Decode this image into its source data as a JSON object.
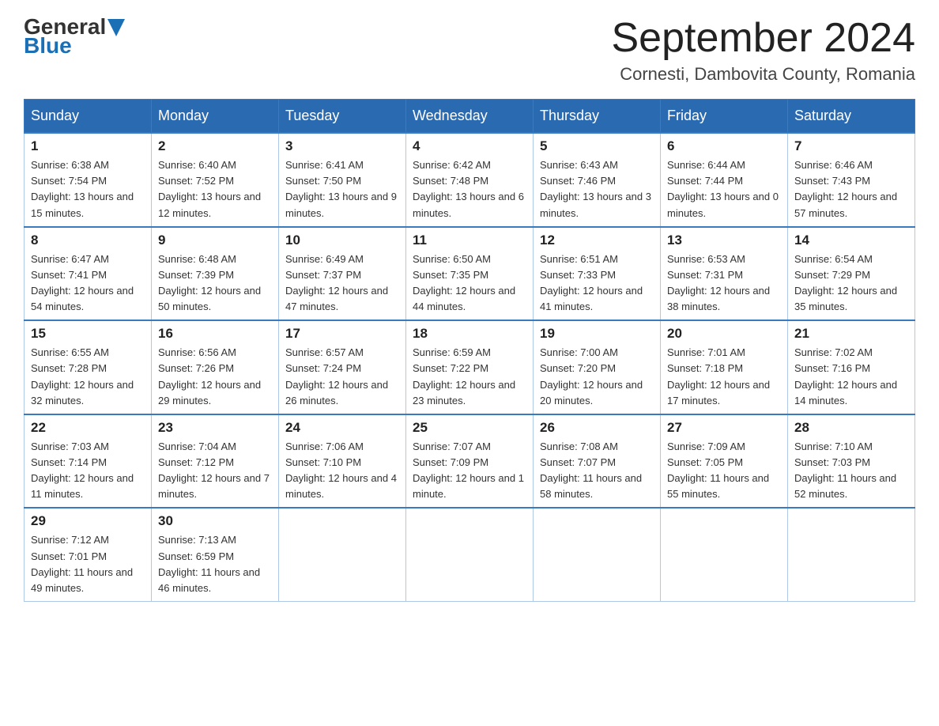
{
  "header": {
    "logo_general": "General",
    "logo_blue": "Blue",
    "month_title": "September 2024",
    "location": "Cornesti, Dambovita County, Romania"
  },
  "weekdays": [
    "Sunday",
    "Monday",
    "Tuesday",
    "Wednesday",
    "Thursday",
    "Friday",
    "Saturday"
  ],
  "weeks": [
    [
      {
        "day": "1",
        "sunrise": "6:38 AM",
        "sunset": "7:54 PM",
        "daylight": "13 hours and 15 minutes."
      },
      {
        "day": "2",
        "sunrise": "6:40 AM",
        "sunset": "7:52 PM",
        "daylight": "13 hours and 12 minutes."
      },
      {
        "day": "3",
        "sunrise": "6:41 AM",
        "sunset": "7:50 PM",
        "daylight": "13 hours and 9 minutes."
      },
      {
        "day": "4",
        "sunrise": "6:42 AM",
        "sunset": "7:48 PM",
        "daylight": "13 hours and 6 minutes."
      },
      {
        "day": "5",
        "sunrise": "6:43 AM",
        "sunset": "7:46 PM",
        "daylight": "13 hours and 3 minutes."
      },
      {
        "day": "6",
        "sunrise": "6:44 AM",
        "sunset": "7:44 PM",
        "daylight": "13 hours and 0 minutes."
      },
      {
        "day": "7",
        "sunrise": "6:46 AM",
        "sunset": "7:43 PM",
        "daylight": "12 hours and 57 minutes."
      }
    ],
    [
      {
        "day": "8",
        "sunrise": "6:47 AM",
        "sunset": "7:41 PM",
        "daylight": "12 hours and 54 minutes."
      },
      {
        "day": "9",
        "sunrise": "6:48 AM",
        "sunset": "7:39 PM",
        "daylight": "12 hours and 50 minutes."
      },
      {
        "day": "10",
        "sunrise": "6:49 AM",
        "sunset": "7:37 PM",
        "daylight": "12 hours and 47 minutes."
      },
      {
        "day": "11",
        "sunrise": "6:50 AM",
        "sunset": "7:35 PM",
        "daylight": "12 hours and 44 minutes."
      },
      {
        "day": "12",
        "sunrise": "6:51 AM",
        "sunset": "7:33 PM",
        "daylight": "12 hours and 41 minutes."
      },
      {
        "day": "13",
        "sunrise": "6:53 AM",
        "sunset": "7:31 PM",
        "daylight": "12 hours and 38 minutes."
      },
      {
        "day": "14",
        "sunrise": "6:54 AM",
        "sunset": "7:29 PM",
        "daylight": "12 hours and 35 minutes."
      }
    ],
    [
      {
        "day": "15",
        "sunrise": "6:55 AM",
        "sunset": "7:28 PM",
        "daylight": "12 hours and 32 minutes."
      },
      {
        "day": "16",
        "sunrise": "6:56 AM",
        "sunset": "7:26 PM",
        "daylight": "12 hours and 29 minutes."
      },
      {
        "day": "17",
        "sunrise": "6:57 AM",
        "sunset": "7:24 PM",
        "daylight": "12 hours and 26 minutes."
      },
      {
        "day": "18",
        "sunrise": "6:59 AM",
        "sunset": "7:22 PM",
        "daylight": "12 hours and 23 minutes."
      },
      {
        "day": "19",
        "sunrise": "7:00 AM",
        "sunset": "7:20 PM",
        "daylight": "12 hours and 20 minutes."
      },
      {
        "day": "20",
        "sunrise": "7:01 AM",
        "sunset": "7:18 PM",
        "daylight": "12 hours and 17 minutes."
      },
      {
        "day": "21",
        "sunrise": "7:02 AM",
        "sunset": "7:16 PM",
        "daylight": "12 hours and 14 minutes."
      }
    ],
    [
      {
        "day": "22",
        "sunrise": "7:03 AM",
        "sunset": "7:14 PM",
        "daylight": "12 hours and 11 minutes."
      },
      {
        "day": "23",
        "sunrise": "7:04 AM",
        "sunset": "7:12 PM",
        "daylight": "12 hours and 7 minutes."
      },
      {
        "day": "24",
        "sunrise": "7:06 AM",
        "sunset": "7:10 PM",
        "daylight": "12 hours and 4 minutes."
      },
      {
        "day": "25",
        "sunrise": "7:07 AM",
        "sunset": "7:09 PM",
        "daylight": "12 hours and 1 minute."
      },
      {
        "day": "26",
        "sunrise": "7:08 AM",
        "sunset": "7:07 PM",
        "daylight": "11 hours and 58 minutes."
      },
      {
        "day": "27",
        "sunrise": "7:09 AM",
        "sunset": "7:05 PM",
        "daylight": "11 hours and 55 minutes."
      },
      {
        "day": "28",
        "sunrise": "7:10 AM",
        "sunset": "7:03 PM",
        "daylight": "11 hours and 52 minutes."
      }
    ],
    [
      {
        "day": "29",
        "sunrise": "7:12 AM",
        "sunset": "7:01 PM",
        "daylight": "11 hours and 49 minutes."
      },
      {
        "day": "30",
        "sunrise": "7:13 AM",
        "sunset": "6:59 PM",
        "daylight": "11 hours and 46 minutes."
      },
      null,
      null,
      null,
      null,
      null
    ]
  ]
}
